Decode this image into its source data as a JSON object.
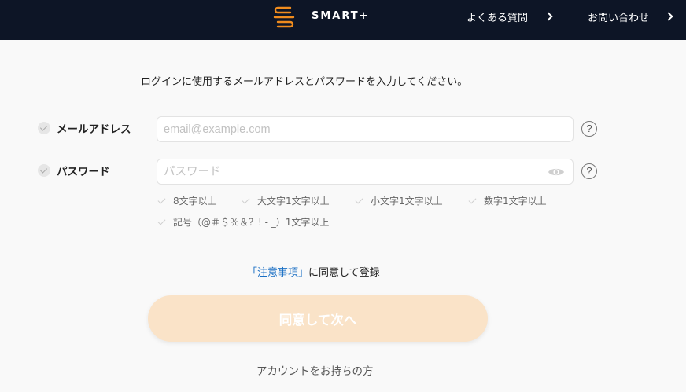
{
  "header": {
    "brand_name": "SMART+",
    "nav": [
      {
        "label": "よくある質問"
      },
      {
        "label": "お問い合わせ"
      }
    ]
  },
  "form": {
    "instruction": "ログインに使用するメールアドレスとパスワードを入力してください。",
    "email": {
      "label": "メールアドレス",
      "placeholder": "email@example.com",
      "value": ""
    },
    "password": {
      "label": "パスワード",
      "placeholder": "パスワード",
      "value": ""
    },
    "help_glyph": "?",
    "password_rules": [
      "8文字以上",
      "大文字1文字以上",
      "小文字1文字以上",
      "数字1文字以上",
      "記号（@＃＄％＆？! - _）1文字以上"
    ],
    "terms": {
      "open_bracket": "「",
      "link_text": "注意事項",
      "close_bracket": "」",
      "suffix": "に同意して登録"
    },
    "submit_label": "同意して次へ",
    "account_link": "アカウントをお持ちの方"
  },
  "colors": {
    "header_bg": "#0d1526",
    "brand_orange": "#f08c1e",
    "button_disabled": "#fae3c8",
    "link_blue": "#1a6fc4",
    "page_bg": "#f9f9f9"
  },
  "icons": {
    "brand_logo": "smart-s-logo-icon",
    "nav_chevron": "chevron-right-icon",
    "field_check": "check-circle-icon",
    "help": "question-circle-icon",
    "eye": "eye-icon",
    "rule_check": "checkmark-icon"
  }
}
